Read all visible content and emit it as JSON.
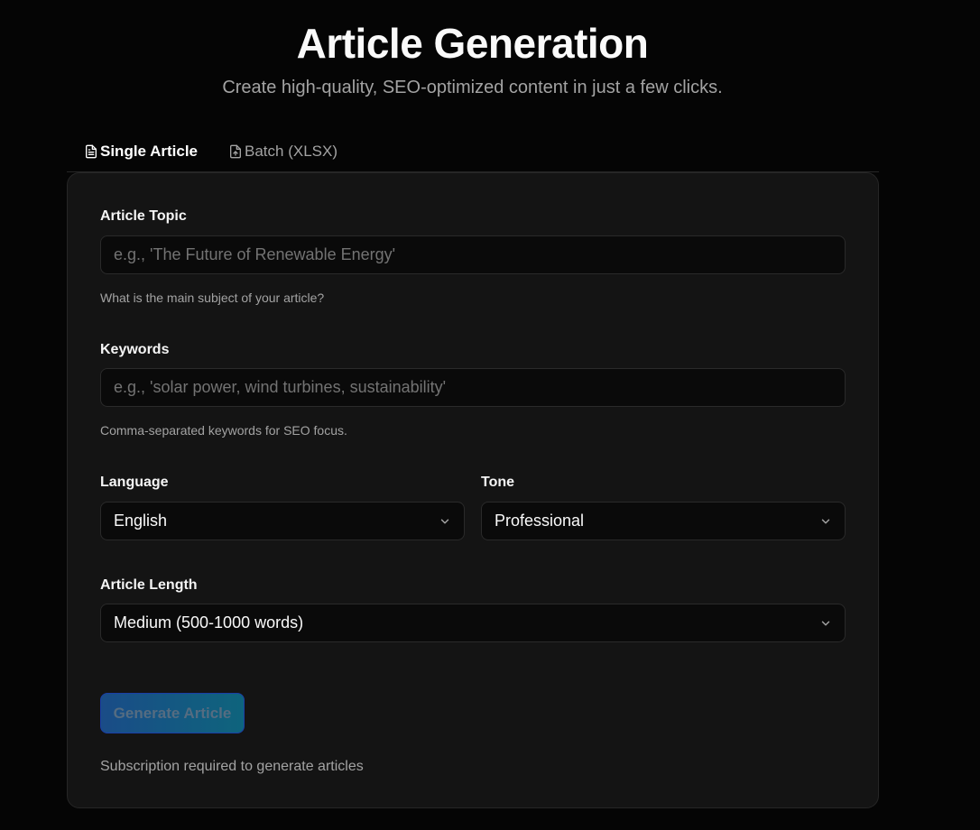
{
  "header": {
    "title": "Article Generation",
    "subtitle": "Create high-quality, SEO-optimized content in just a few clicks."
  },
  "tabs": [
    {
      "label": "Single Article",
      "icon": "file-text-icon",
      "active": true
    },
    {
      "label": "Batch (XLSX)",
      "icon": "file-upload-icon",
      "active": false
    }
  ],
  "form": {
    "topic": {
      "label": "Article Topic",
      "placeholder": "e.g., 'The Future of Renewable Energy'",
      "value": "",
      "help": "What is the main subject of your article?"
    },
    "keywords": {
      "label": "Keywords",
      "placeholder": "e.g., 'solar power, wind turbines, sustainability'",
      "value": "",
      "help": "Comma-separated keywords for SEO focus."
    },
    "language": {
      "label": "Language",
      "selected": "English"
    },
    "tone": {
      "label": "Tone",
      "selected": "Professional"
    },
    "length": {
      "label": "Article Length",
      "selected": "Medium (500-1000 words)"
    },
    "submit_label": "Generate Article",
    "note": "Subscription required to generate articles"
  },
  "colors": {
    "background": "#050505",
    "card": "#141414",
    "button_gradient_start": "#1c5fae",
    "button_gradient_end": "#0d7fa0"
  }
}
